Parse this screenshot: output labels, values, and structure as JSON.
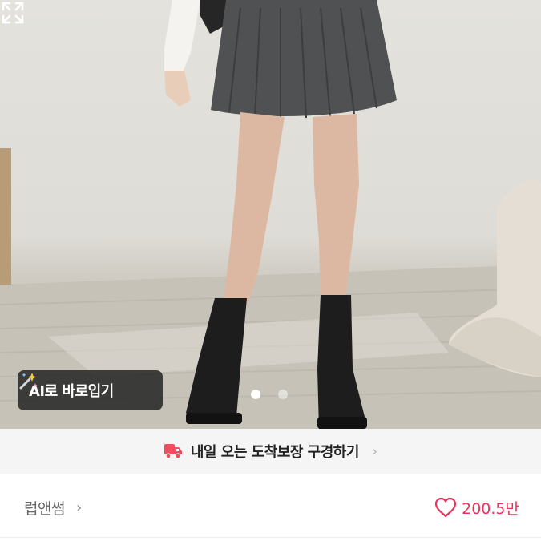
{
  "photo": {
    "ai_button_label": "AI로 바로입기",
    "ai_icon": "magic-wand-icon",
    "expand_icon": "expand-icon",
    "carousel": {
      "total": 2,
      "active": 1
    }
  },
  "promo": {
    "icon": "delivery-truck-icon",
    "text": "내일 오는 도착보장 구경하기",
    "chevron": "›"
  },
  "seller": {
    "name": "럽앤썸",
    "chevron": "›"
  },
  "likes": {
    "icon": "heart-outline-icon",
    "count": "200.5만"
  },
  "colors": {
    "accent": "#e8345a",
    "promo_bg": "#f5f5f5",
    "overlay_button_bg": "#282828"
  }
}
